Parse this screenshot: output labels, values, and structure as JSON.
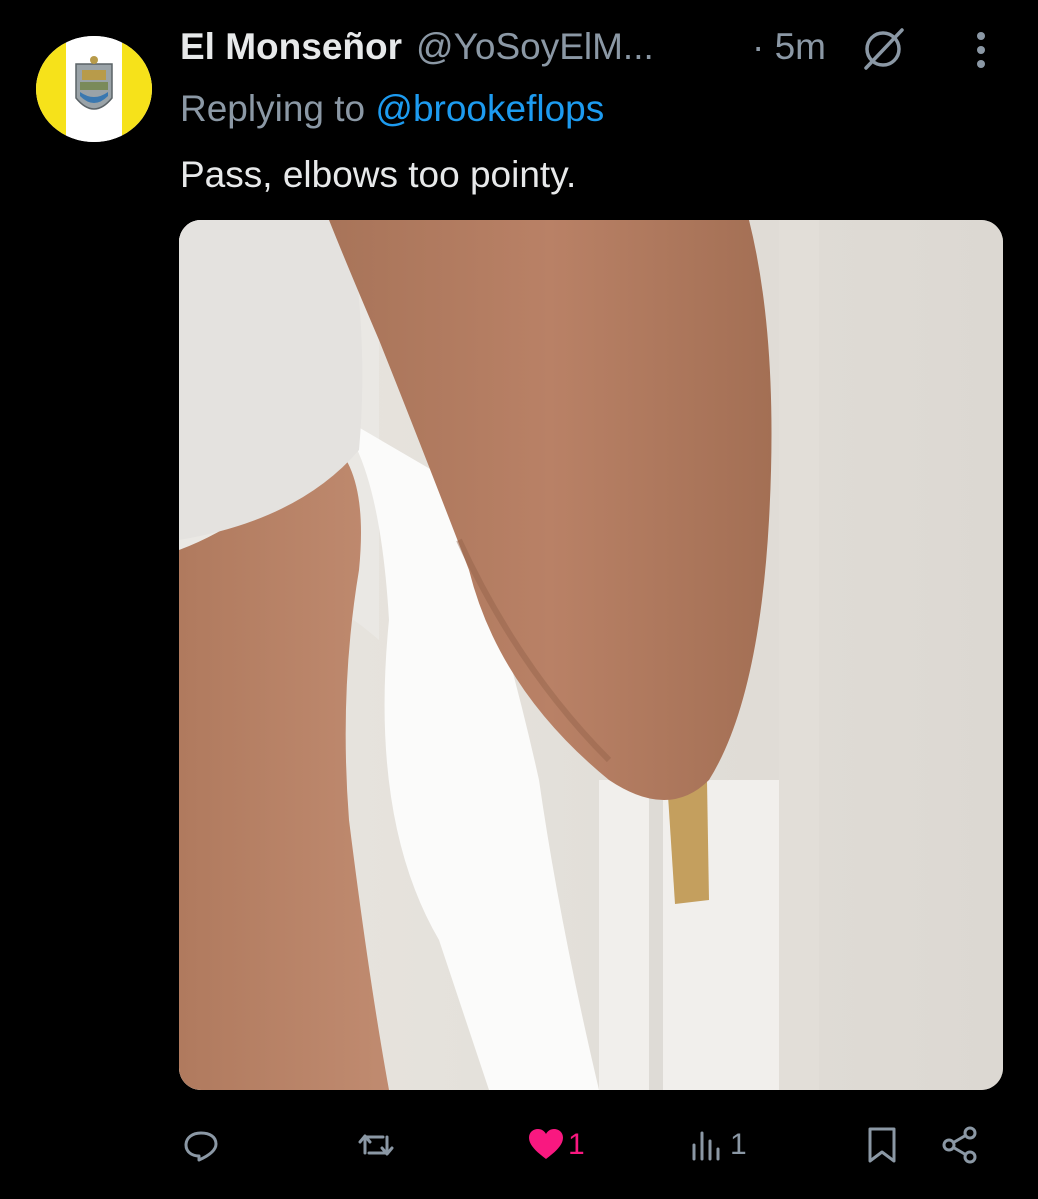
{
  "tweet": {
    "author_name": "El Monseñor",
    "handle": "@YoSoyElM...",
    "time": "· 5m",
    "replying_prefix": "Replying to ",
    "replying_to": "@brookeflops",
    "text": "Pass, elbows too pointy."
  },
  "icons": {
    "avatar": "crest-avatar",
    "grok": "grok-icon",
    "more": "more-vertical-icon",
    "reply": "reply-icon",
    "retweet": "retweet-icon",
    "like": "heart-icon",
    "views": "views-icon",
    "bookmark": "bookmark-icon",
    "share": "share-icon"
  },
  "actions": {
    "likes": "1",
    "views": "1"
  },
  "colors": {
    "background": "#000000",
    "text_primary": "#e7e9ea",
    "text_secondary": "#8b98a5",
    "link": "#1d9bf0",
    "liked": "#f91880",
    "avatar_yellow": "#f6e21a"
  }
}
